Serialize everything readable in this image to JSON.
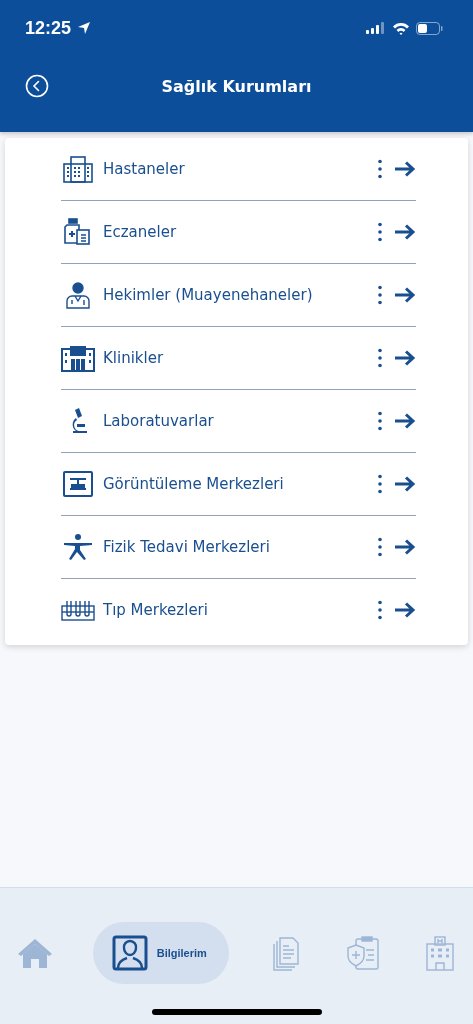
{
  "status_bar": {
    "time": "12:25"
  },
  "header": {
    "title": "Sağlık Kurumları"
  },
  "items": [
    {
      "kind": "hospital",
      "label": "Hastaneler"
    },
    {
      "kind": "pharmacy",
      "label": "Eczaneler"
    },
    {
      "kind": "doctor",
      "label": "Hekimler (Muayenehaneler)"
    },
    {
      "kind": "clinic",
      "label": "Klinikler"
    },
    {
      "kind": "lab",
      "label": "Laboratuvarlar"
    },
    {
      "kind": "imaging",
      "label": "Görüntüleme Merkezleri"
    },
    {
      "kind": "physio",
      "label": "Fizik Tedavi Merkezleri"
    },
    {
      "kind": "medical",
      "label": "Tıp Merkezleri"
    }
  ],
  "tabs": [
    {
      "kind": "home",
      "selected": false
    },
    {
      "kind": "profile",
      "label": "Bilgilerim",
      "selected": true
    },
    {
      "kind": "documents",
      "selected": false
    },
    {
      "kind": "insurance",
      "selected": false
    },
    {
      "kind": "hospital",
      "selected": false
    }
  ]
}
